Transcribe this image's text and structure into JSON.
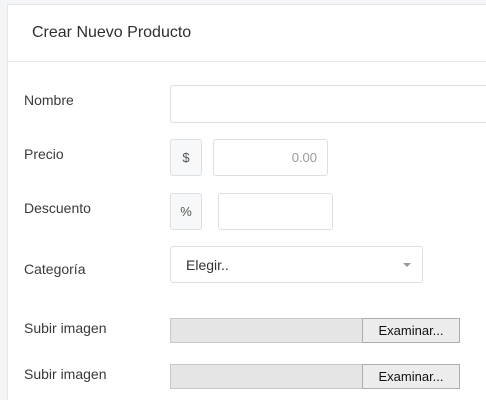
{
  "form": {
    "title": "Crear Nuevo Producto",
    "nombre": {
      "label": "Nombre",
      "value": ""
    },
    "precio": {
      "label": "Precio",
      "addon": "$",
      "placeholder": "0.00",
      "value": ""
    },
    "descuento": {
      "label": "Descuento",
      "addon": "%",
      "value": ""
    },
    "categoria": {
      "label": "Categoría",
      "selected": "Elegir.."
    },
    "uploads": [
      {
        "label": "Subir imagen",
        "button": "Examinar..."
      },
      {
        "label": "Subir imagen",
        "button": "Examinar..."
      }
    ]
  },
  "icons": {
    "select_caret": "chevron-down-icon"
  },
  "colors": {
    "page_background": "#f4f5f7",
    "panel_background": "#ffffff",
    "border": "#dcdfe3",
    "addon_background": "#f7f8f9",
    "file_track": "#e5e5e5"
  }
}
